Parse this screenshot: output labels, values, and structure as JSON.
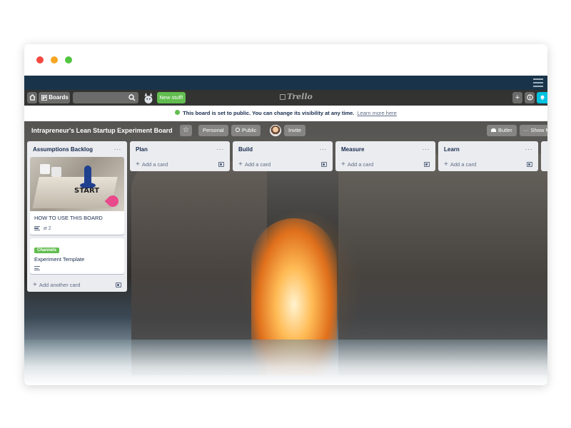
{
  "window": {
    "controls": [
      "close",
      "minimize",
      "maximize"
    ]
  },
  "header": {
    "boards_label": "Boards",
    "search_value": "",
    "new_stuff_label": "New stuff!",
    "logo_text": "Trello"
  },
  "notice": {
    "text": "This board is set to public. You can change its visibility at any time.",
    "link": "Learn more here"
  },
  "board": {
    "title": "Intrapreneur's Lean Startup Experiment Board",
    "team_label": "Personal",
    "visibility_label": "Public",
    "invite_label": "Invite",
    "butler_label": "Butler",
    "show_menu_label": "Show Menu"
  },
  "lists": [
    {
      "title": "Assumptions Backlog",
      "menu": "···",
      "add_label": "Add another card",
      "cards": [
        {
          "title": "HOW TO USE THIS BOARD",
          "cover_text": "START",
          "attachments": "2"
        },
        {
          "label": "Channels",
          "title": "Experiment Template"
        }
      ]
    },
    {
      "title": "Plan",
      "menu": "···",
      "add_label": "Add a card"
    },
    {
      "title": "Build",
      "menu": "···",
      "add_label": "Add a card"
    },
    {
      "title": "Measure",
      "menu": "···",
      "add_label": "Add a card"
    },
    {
      "title": "Learn",
      "menu": "···",
      "add_label": "Add a card"
    }
  ],
  "colors": {
    "nav": "#19344a",
    "accent_green": "#61bd4f",
    "list_bg": "#ebecf0"
  }
}
